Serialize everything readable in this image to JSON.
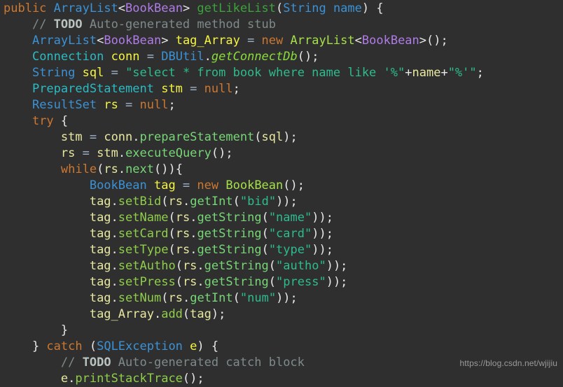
{
  "editor": {
    "background_color": "#2f2f2f",
    "language": "java",
    "font_size_px": 17,
    "line_height_px": 23
  },
  "watermark": {
    "text": "https://blog.csdn.net/wjijiu",
    "color": "#9a9a9a"
  },
  "theme_colors": {
    "keyword": "#cc7832",
    "class_type": "#3b92d6",
    "interface_type": "#2bbbc4",
    "generic_type": "#b07ce8",
    "method_declaration": "#3ca33c",
    "method_call": "#77d777",
    "static_method_call": "#88dd3a",
    "setter_call": "#8fce4a",
    "local_variable": "#f5f541",
    "variable_usage": "#e8e8a0",
    "string_literal": "#2dbc8e",
    "punctuation": "#e8e8e8",
    "comment": "#7f8a8a",
    "comment_todo": "#b9c4c0",
    "constructor": "#a5e04a"
  },
  "code": {
    "lines": [
      {
        "n": 1,
        "text": "public ArrayList<BookBean> getLikeList(String name) {"
      },
      {
        "n": 2,
        "text": "    // TODO Auto-generated method stub"
      },
      {
        "n": 3,
        "text": "    ArrayList<BookBean> tag_Array = new ArrayList<BookBean>();"
      },
      {
        "n": 4,
        "text": "    Connection conn = DBUtil.getConnectDb();"
      },
      {
        "n": 5,
        "text": "    String sql = \"select * from book where name like '%\"+name+\"%'\";"
      },
      {
        "n": 6,
        "text": "    PreparedStatement stm = null;"
      },
      {
        "n": 7,
        "text": "    ResultSet rs = null;"
      },
      {
        "n": 8,
        "text": "    try {"
      },
      {
        "n": 9,
        "text": "        stm = conn.prepareStatement(sql);"
      },
      {
        "n": 10,
        "text": "        rs = stm.executeQuery();"
      },
      {
        "n": 11,
        "text": "        while(rs.next()){"
      },
      {
        "n": 12,
        "text": "            BookBean tag = new BookBean();"
      },
      {
        "n": 13,
        "text": "            tag.setBid(rs.getInt(\"bid\"));"
      },
      {
        "n": 14,
        "text": "            tag.setName(rs.getString(\"name\"));"
      },
      {
        "n": 15,
        "text": "            tag.setCard(rs.getString(\"card\"));"
      },
      {
        "n": 16,
        "text": "            tag.setType(rs.getString(\"type\"));"
      },
      {
        "n": 17,
        "text": "            tag.setAutho(rs.getString(\"autho\"));"
      },
      {
        "n": 18,
        "text": "            tag.setPress(rs.getString(\"press\"));"
      },
      {
        "n": 19,
        "text": "            tag.setNum(rs.getInt(\"num\"));"
      },
      {
        "n": 20,
        "text": "            tag_Array.add(tag);"
      },
      {
        "n": 21,
        "text": "        }"
      },
      {
        "n": 22,
        "text": "    } catch (SQLException e) {"
      },
      {
        "n": 23,
        "text": "        // TODO Auto-generated catch block"
      },
      {
        "n": 24,
        "text": "        e.printStackTrace();"
      }
    ],
    "tokens": [
      [
        [
          "public",
          "kw"
        ],
        [
          " ",
          "punc"
        ],
        [
          "ArrayList",
          "cls"
        ],
        [
          "<",
          "punc"
        ],
        [
          "BookBean",
          "gen"
        ],
        [
          "> ",
          "punc"
        ],
        [
          "getLikeList",
          "mdecl"
        ],
        [
          "(",
          "punc"
        ],
        [
          "String",
          "cls"
        ],
        [
          " ",
          "punc"
        ],
        [
          "name",
          "cls"
        ],
        [
          ") {",
          "punc"
        ]
      ],
      [
        [
          "    ",
          "punc"
        ],
        [
          "// ",
          "cmt"
        ],
        [
          "TODO",
          "todo"
        ],
        [
          " Auto-generated method stub",
          "cmt"
        ]
      ],
      [
        [
          "    ",
          "punc"
        ],
        [
          "ArrayList",
          "cls"
        ],
        [
          "<",
          "punc"
        ],
        [
          "BookBean",
          "gen"
        ],
        [
          "> ",
          "punc"
        ],
        [
          "tag_Array",
          "var"
        ],
        [
          " = ",
          "op"
        ],
        [
          "new",
          "kw"
        ],
        [
          " ",
          "punc"
        ],
        [
          "ArrayList",
          "ctor"
        ],
        [
          "<",
          "punc"
        ],
        [
          "BookBean",
          "gen"
        ],
        [
          ">();",
          "punc"
        ]
      ],
      [
        [
          "    ",
          "punc"
        ],
        [
          "Connection",
          "iface"
        ],
        [
          " ",
          "punc"
        ],
        [
          "conn",
          "var"
        ],
        [
          " = ",
          "op"
        ],
        [
          "DBUtil",
          "cls"
        ],
        [
          ".",
          "punc"
        ],
        [
          "getConnectDb",
          "mstat"
        ],
        [
          "();",
          "punc"
        ]
      ],
      [
        [
          "    ",
          "punc"
        ],
        [
          "String",
          "cls"
        ],
        [
          " ",
          "punc"
        ],
        [
          "sql",
          "var"
        ],
        [
          " = ",
          "op"
        ],
        [
          "\"select * from book where name like '%\"",
          "str"
        ],
        [
          "+",
          "punc"
        ],
        [
          "name",
          "varu"
        ],
        [
          "+",
          "punc"
        ],
        [
          "\"%'\"",
          "str"
        ],
        [
          ";",
          "punc"
        ]
      ],
      [
        [
          "    ",
          "punc"
        ],
        [
          "PreparedStatement",
          "iface"
        ],
        [
          " ",
          "punc"
        ],
        [
          "stm",
          "var"
        ],
        [
          " = ",
          "op"
        ],
        [
          "null",
          "kw"
        ],
        [
          ";",
          "punc"
        ]
      ],
      [
        [
          "    ",
          "punc"
        ],
        [
          "ResultSet",
          "cls"
        ],
        [
          " ",
          "punc"
        ],
        [
          "rs",
          "var"
        ],
        [
          " = ",
          "op"
        ],
        [
          "null",
          "kw"
        ],
        [
          ";",
          "punc"
        ]
      ],
      [
        [
          "    ",
          "punc"
        ],
        [
          "try",
          "kw"
        ],
        [
          " {",
          "punc"
        ]
      ],
      [
        [
          "        ",
          "punc"
        ],
        [
          "stm",
          "varu"
        ],
        [
          " = ",
          "op"
        ],
        [
          "conn",
          "varu"
        ],
        [
          ".",
          "punc"
        ],
        [
          "prepareStatement",
          "mcall"
        ],
        [
          "(",
          "punc"
        ],
        [
          "sql",
          "varu"
        ],
        [
          ");",
          "punc"
        ]
      ],
      [
        [
          "        ",
          "punc"
        ],
        [
          "rs",
          "varu"
        ],
        [
          " = ",
          "op"
        ],
        [
          "stm",
          "varu"
        ],
        [
          ".",
          "punc"
        ],
        [
          "executeQuery",
          "mcall"
        ],
        [
          "();",
          "punc"
        ]
      ],
      [
        [
          "        ",
          "punc"
        ],
        [
          "while",
          "kw"
        ],
        [
          "(",
          "punc"
        ],
        [
          "rs",
          "varu"
        ],
        [
          ".",
          "punc"
        ],
        [
          "next",
          "mcall"
        ],
        [
          "()){",
          "punc"
        ]
      ],
      [
        [
          "            ",
          "punc"
        ],
        [
          "BookBean",
          "cls"
        ],
        [
          " ",
          "punc"
        ],
        [
          "tag",
          "var"
        ],
        [
          " = ",
          "op"
        ],
        [
          "new",
          "kw"
        ],
        [
          " ",
          "punc"
        ],
        [
          "BookBean",
          "ctor"
        ],
        [
          "();",
          "punc"
        ]
      ],
      [
        [
          "            ",
          "punc"
        ],
        [
          "tag",
          "varu"
        ],
        [
          ".",
          "punc"
        ],
        [
          "setBid",
          "mcall2"
        ],
        [
          "(",
          "punc"
        ],
        [
          "rs",
          "varu"
        ],
        [
          ".",
          "punc"
        ],
        [
          "getInt",
          "mcall"
        ],
        [
          "(",
          "punc"
        ],
        [
          "\"bid\"",
          "str"
        ],
        [
          "));",
          "punc"
        ]
      ],
      [
        [
          "            ",
          "punc"
        ],
        [
          "tag",
          "varu"
        ],
        [
          ".",
          "punc"
        ],
        [
          "setName",
          "mcall2"
        ],
        [
          "(",
          "punc"
        ],
        [
          "rs",
          "varu"
        ],
        [
          ".",
          "punc"
        ],
        [
          "getString",
          "mcall"
        ],
        [
          "(",
          "punc"
        ],
        [
          "\"name\"",
          "str"
        ],
        [
          "));",
          "punc"
        ]
      ],
      [
        [
          "            ",
          "punc"
        ],
        [
          "tag",
          "varu"
        ],
        [
          ".",
          "punc"
        ],
        [
          "setCard",
          "mcall2"
        ],
        [
          "(",
          "punc"
        ],
        [
          "rs",
          "varu"
        ],
        [
          ".",
          "punc"
        ],
        [
          "getString",
          "mcall"
        ],
        [
          "(",
          "punc"
        ],
        [
          "\"card\"",
          "str"
        ],
        [
          "));",
          "punc"
        ]
      ],
      [
        [
          "            ",
          "punc"
        ],
        [
          "tag",
          "varu"
        ],
        [
          ".",
          "punc"
        ],
        [
          "setType",
          "mcall2"
        ],
        [
          "(",
          "punc"
        ],
        [
          "rs",
          "varu"
        ],
        [
          ".",
          "punc"
        ],
        [
          "getString",
          "mcall"
        ],
        [
          "(",
          "punc"
        ],
        [
          "\"type\"",
          "str"
        ],
        [
          "));",
          "punc"
        ]
      ],
      [
        [
          "            ",
          "punc"
        ],
        [
          "tag",
          "varu"
        ],
        [
          ".",
          "punc"
        ],
        [
          "setAutho",
          "mcall2"
        ],
        [
          "(",
          "punc"
        ],
        [
          "rs",
          "varu"
        ],
        [
          ".",
          "punc"
        ],
        [
          "getString",
          "mcall"
        ],
        [
          "(",
          "punc"
        ],
        [
          "\"autho\"",
          "str"
        ],
        [
          "));",
          "punc"
        ]
      ],
      [
        [
          "            ",
          "punc"
        ],
        [
          "tag",
          "varu"
        ],
        [
          ".",
          "punc"
        ],
        [
          "setPress",
          "mcall2"
        ],
        [
          "(",
          "punc"
        ],
        [
          "rs",
          "varu"
        ],
        [
          ".",
          "punc"
        ],
        [
          "getString",
          "mcall"
        ],
        [
          "(",
          "punc"
        ],
        [
          "\"press\"",
          "str"
        ],
        [
          "));",
          "punc"
        ]
      ],
      [
        [
          "            ",
          "punc"
        ],
        [
          "tag",
          "varu"
        ],
        [
          ".",
          "punc"
        ],
        [
          "setNum",
          "mcall2"
        ],
        [
          "(",
          "punc"
        ],
        [
          "rs",
          "varu"
        ],
        [
          ".",
          "punc"
        ],
        [
          "getInt",
          "mcall"
        ],
        [
          "(",
          "punc"
        ],
        [
          "\"num\"",
          "str"
        ],
        [
          "));",
          "punc"
        ]
      ],
      [
        [
          "            ",
          "punc"
        ],
        [
          "tag_Array",
          "varu"
        ],
        [
          ".",
          "punc"
        ],
        [
          "add",
          "mcall2"
        ],
        [
          "(",
          "punc"
        ],
        [
          "tag",
          "varu"
        ],
        [
          ");",
          "punc"
        ]
      ],
      [
        [
          "        }",
          "punc"
        ]
      ],
      [
        [
          "    } ",
          "punc"
        ],
        [
          "catch",
          "kw"
        ],
        [
          " (",
          "punc"
        ],
        [
          "SQLException",
          "cls"
        ],
        [
          " ",
          "punc"
        ],
        [
          "e",
          "var"
        ],
        [
          ") {",
          "punc"
        ]
      ],
      [
        [
          "        ",
          "punc"
        ],
        [
          "// ",
          "cmt"
        ],
        [
          "TODO",
          "todo"
        ],
        [
          " Auto-generated catch block",
          "cmt"
        ]
      ],
      [
        [
          "        ",
          "punc"
        ],
        [
          "e",
          "varu"
        ],
        [
          ".",
          "punc"
        ],
        [
          "printStackTrace",
          "mcall2"
        ],
        [
          "();",
          "punc"
        ]
      ]
    ]
  }
}
